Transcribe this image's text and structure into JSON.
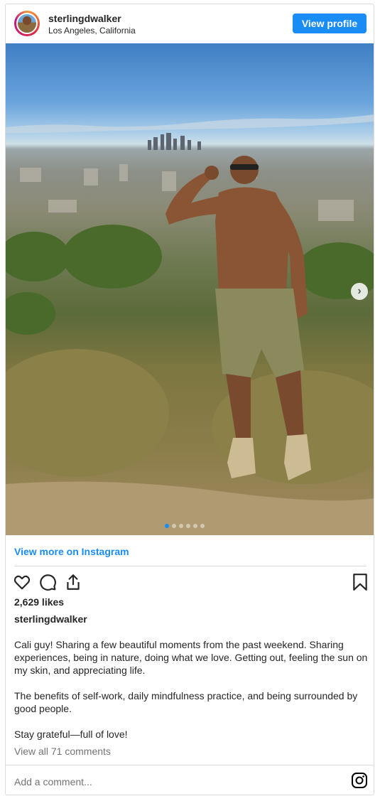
{
  "header": {
    "username": "sterlingdwalker",
    "location": "Los Angeles, California",
    "view_profile_label": "View profile"
  },
  "media": {
    "image_alt": "sterlingdwalker post photo",
    "slide_count": 6,
    "current_slide": 1
  },
  "links": {
    "view_more": "View more on Instagram"
  },
  "actions": {
    "icons": [
      "heart-icon",
      "comment-icon",
      "share-icon",
      "bookmark-icon"
    ]
  },
  "post": {
    "likes": "2,629 likes",
    "caption_username": "sterlingdwalker",
    "caption_paragraphs": [
      "Cali guy! Sharing a few beautiful moments from the past weekend. Sharing experiences, being in nature, doing what we love. Getting out, feeling the sun on my skin, and appreciating life.",
      "The benefits of self-work, daily mindfulness practice, and being surrounded by good people.",
      "Stay grateful—full of love!"
    ],
    "view_comments": "View all 71 comments"
  },
  "comment_box": {
    "placeholder": "Add a comment..."
  },
  "colors": {
    "accent": "#1a8cf5",
    "text": "#262626",
    "muted": "#737373",
    "border": "#dbdbdb"
  }
}
